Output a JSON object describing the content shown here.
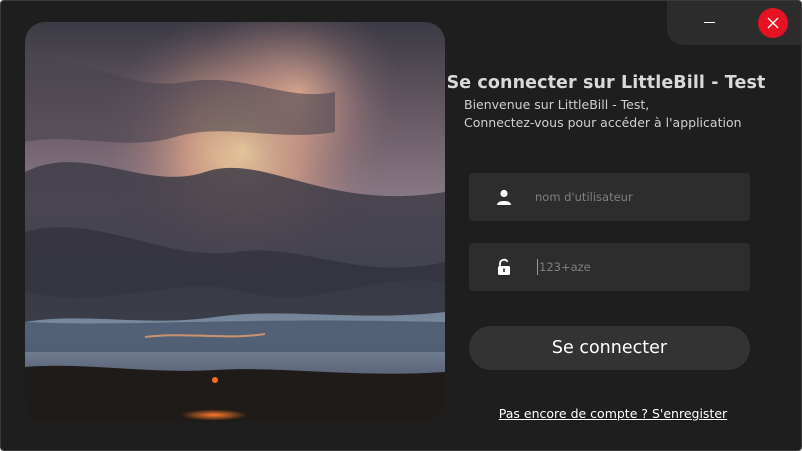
{
  "window": {
    "minimize_icon": "minimize-icon",
    "close_icon": "close-icon",
    "close_color": "#e81123"
  },
  "hero": {
    "image": "sunset-cloudy-sky-photo"
  },
  "login": {
    "title": "Se connecter sur LittleBill - Test",
    "welcome_line1": "Bienvenue sur LittleBill - Test,",
    "welcome_line2": "Connectez-vous pour accéder à l'application",
    "username_placeholder": "nom d'utilisateur",
    "username_icon": "user-icon",
    "password_placeholder": "123+aze",
    "password_icon": "unlock-icon",
    "submit_label": "Se connecter",
    "register_link": "Pas encore de compte ? S'enregister"
  },
  "colors": {
    "background": "#1e1e1e",
    "field": "#2d2d2d",
    "button": "#333333"
  }
}
